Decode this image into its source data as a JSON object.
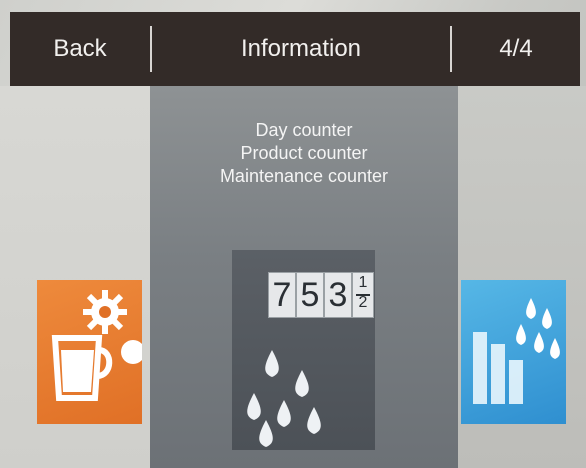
{
  "header": {
    "back_label": "Back",
    "title": "Information",
    "page_indicator": "4/4"
  },
  "menu": {
    "lines": [
      "Day counter",
      "Product counter",
      "Maintenance counter"
    ]
  },
  "counter": {
    "digits": [
      "7",
      "5",
      "3"
    ],
    "fraction": {
      "numerator": "1",
      "denominator": "2"
    }
  },
  "icons": {
    "left": "coffee-cup-gears-icon",
    "center": "water-drops-icon",
    "right": "water-drops-glasses-icon"
  },
  "colors": {
    "header_bg": "#332b28",
    "left_tile": "#e07026",
    "right_tile": "#2f8fd0",
    "center_panel": "#7a7f83"
  }
}
